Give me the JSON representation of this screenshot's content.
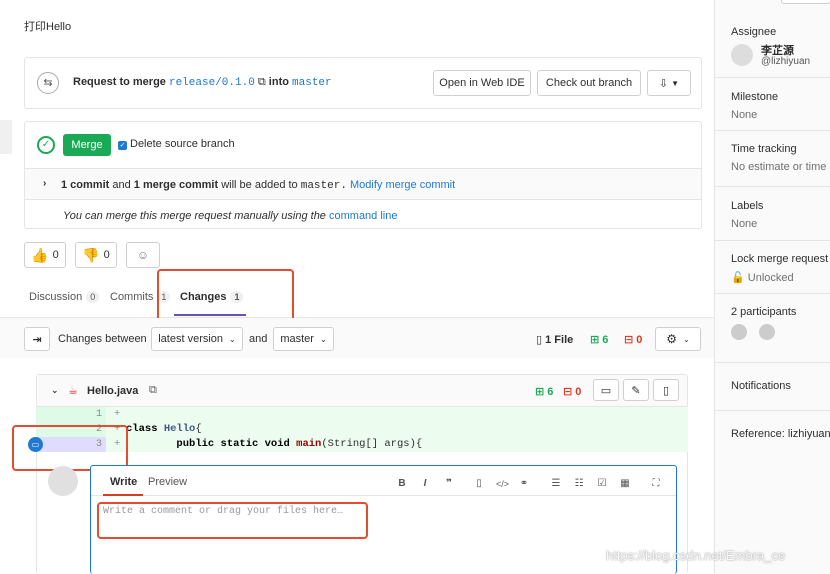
{
  "description": "打印Hello",
  "merge_request": {
    "request_prefix": "Request to merge",
    "source_branch": "release/0.1.0",
    "into_label": "into",
    "target_branch": "master",
    "open_web_ide": "Open in Web IDE",
    "check_out_branch": "Check out branch"
  },
  "merge_widget": {
    "merge_button": "Merge",
    "delete_source_branch": "Delete source branch",
    "commit_count": "1 commit",
    "and_text": "and",
    "merge_commit_count": "1 merge commit",
    "will_be_added": "will be added to",
    "target": "master.",
    "modify_merge_commit": "Modify merge commit",
    "manual_text": "You can merge this merge request manually using the",
    "command_line": "command line"
  },
  "reactions": {
    "thumbs_up_count": "0",
    "thumbs_down_count": "0"
  },
  "tabs": [
    {
      "label": "Discussion",
      "count": "0"
    },
    {
      "label": "Commits",
      "count": "1"
    },
    {
      "label": "Changes",
      "count": "1"
    }
  ],
  "diff_toolbar": {
    "changes_between": "Changes between",
    "version_select": "latest version",
    "and_label": "and",
    "target_select": "master",
    "file_count": "1 File",
    "added": "6",
    "removed": "0"
  },
  "file": {
    "name": "Hello.java",
    "added": "6",
    "removed": "0",
    "lines": [
      {
        "num": "1",
        "sign": "+",
        "code": ""
      },
      {
        "num": "2",
        "sign": "+",
        "code_kw": "class",
        "code_cls": "Hello",
        "code_rest": "{"
      },
      {
        "num": "3",
        "sign": "+",
        "code_indent": "        ",
        "code_kw": "public static void",
        "code_fn": "main",
        "code_rest": "(String[] args){"
      }
    ]
  },
  "comment": {
    "tab_write": "Write",
    "tab_preview": "Preview",
    "placeholder": "Write a comment or drag your files here…"
  },
  "sidebar": {
    "assignee_title": "Assignee",
    "assignee_name": "李芷源",
    "assignee_handle": "@lizhiyuan",
    "milestone_title": "Milestone",
    "milestone_value": "None",
    "time_title": "Time tracking",
    "time_value": "No estimate or time",
    "labels_title": "Labels",
    "labels_value": "None",
    "lock_title": "Lock merge request",
    "lock_value": "Unlocked",
    "participants_title": "2 participants",
    "notifications_title": "Notifications",
    "reference": "Reference: lizhiyuan"
  },
  "watermark": "https://blog.csdn.net/Embra_ce",
  "colors": {
    "merge_green": "#1aaa55",
    "link_blue": "#1f78d1",
    "highlight_red": "#e34d32",
    "added_line_bg": "#ecfdf0",
    "added_num_bg": "#ddfbe6",
    "selected_line_bg": "#e0dcff"
  }
}
